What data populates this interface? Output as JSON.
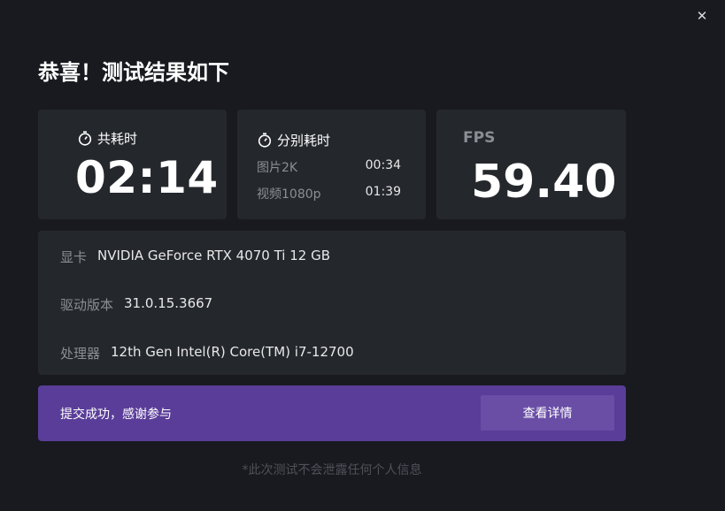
{
  "window": {
    "title": "恭喜！测试结果如下",
    "close_glyph": "✕"
  },
  "total_time": {
    "label": "共耗时",
    "value": "02:14"
  },
  "split_time": {
    "label": "分别耗时",
    "rows": [
      {
        "label": "图片2K",
        "value": "00:34"
      },
      {
        "label": "视频1080p",
        "value": "01:39"
      }
    ]
  },
  "fps": {
    "label": "FPS",
    "value": "59.40"
  },
  "system_info": [
    {
      "label": "显卡",
      "value": "NVIDIA GeForce RTX 4070 Ti 12 GB"
    },
    {
      "label": "驱动版本",
      "value": "31.0.15.3667"
    },
    {
      "label": "处理器",
      "value": "12th Gen Intel(R) Core(TM) i7-12700"
    }
  ],
  "banner": {
    "message": "提交成功，感谢参与",
    "button_label": "查看详情"
  },
  "footer_note": "*此次测试不会泄露任何个人信息",
  "colors": {
    "background": "#181a20",
    "card": "#24272c",
    "accent": "#5a3d99",
    "accent_button": "#6a4ea6",
    "muted_text": "#8b8e94"
  }
}
